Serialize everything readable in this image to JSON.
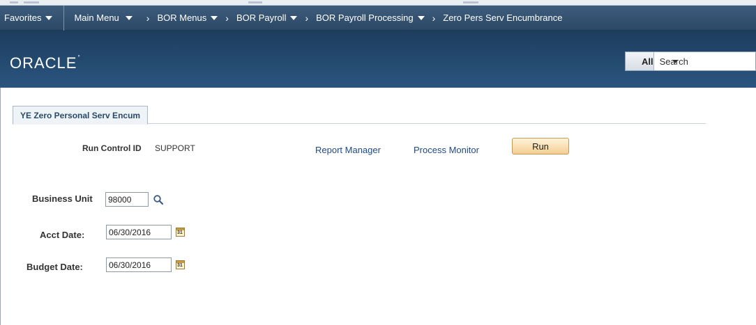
{
  "nav": {
    "favorites": "Favorites",
    "main_menu": "Main Menu",
    "breadcrumbs": [
      "BOR Menus",
      "BOR Payroll",
      "BOR Payroll Processing",
      "Zero Pers Serv Encumbrance"
    ]
  },
  "brand": {
    "logo": "ORACLE",
    "search_scope": "All",
    "search_placeholder": "Search"
  },
  "tab": {
    "label": "YE Zero Personal Serv Encum"
  },
  "form": {
    "run_control_label": "Run Control ID",
    "run_control_value": "SUPPORT",
    "report_manager": "Report Manager",
    "process_monitor": "Process Monitor",
    "run_button": "Run",
    "business_unit_label": "Business Unit",
    "business_unit_value": "98000",
    "acct_date_label": "Acct Date:",
    "acct_date_value": "06/30/2016",
    "budget_date_label": "Budget Date:",
    "budget_date_value": "06/30/2016"
  },
  "colors": {
    "nav_bg": "#2b4966",
    "brand_bg": "#244a70",
    "link": "#204a87",
    "run_button": "#f3ce93"
  },
  "icons": [
    "caret-down-icon",
    "chevron-right-icon",
    "lookup-magnifier-icon",
    "calendar-icon"
  ]
}
